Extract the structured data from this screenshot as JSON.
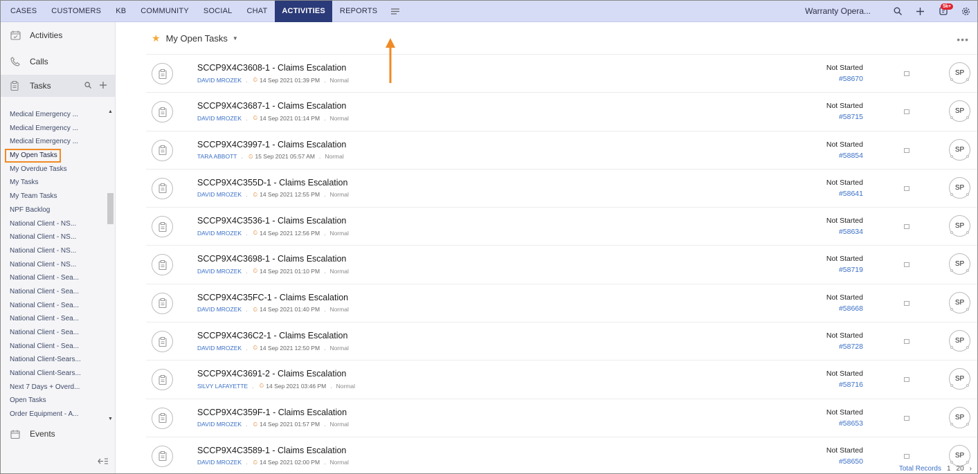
{
  "nav": {
    "items": [
      "CASES",
      "CUSTOMERS",
      "KB",
      "COMMUNITY",
      "SOCIAL",
      "CHAT",
      "ACTIVITIES",
      "REPORTS"
    ],
    "active_index": 6,
    "department": "Warranty Opera...",
    "notification_badge": "5k+"
  },
  "sidebar": {
    "activities": "Activities",
    "calls": "Calls",
    "tasks": "Tasks",
    "events": "Events",
    "views": [
      "Medical Emergency ...",
      "Medical Emergency ...",
      "Medical Emergency ...",
      "My Open Tasks",
      "My Overdue Tasks",
      "My Tasks",
      "My Team Tasks",
      "NPF Backlog",
      "National Client - NS...",
      "National Client - NS...",
      "National Client - NS...",
      "National Client - NS...",
      "National Client - Sea...",
      "National Client - Sea...",
      "National Client - Sea...",
      "National Client - Sea...",
      "National Client - Sea...",
      "National Client - Sea...",
      "National Client-Sears...",
      "National Client-Sears...",
      "Next 7 Days + Overd...",
      "Open Tasks",
      "Order Equipment - A..."
    ],
    "selected_index": 3
  },
  "main": {
    "view_title": "My Open Tasks",
    "tasks": [
      {
        "title": "SCCP9X4C3608-1 - Claims Escalation",
        "owner": "DAVID MROZEK",
        "due": "14 Sep 2021 01:39 PM",
        "priority": "Normal",
        "status": "Not Started",
        "ticket": "#58670",
        "initials": "SP"
      },
      {
        "title": "SCCP9X4C3687-1 - Claims Escalation",
        "owner": "DAVID MROZEK",
        "due": "14 Sep 2021 01:14 PM",
        "priority": "Normal",
        "status": "Not Started",
        "ticket": "#58715",
        "initials": "SP"
      },
      {
        "title": "SCCP9X4C3997-1 - Claims Escalation",
        "owner": "TARA ABBOTT",
        "due": "15 Sep 2021 05:57 AM",
        "priority": "Normal",
        "status": "Not Started",
        "ticket": "#58854",
        "initials": "SP"
      },
      {
        "title": "SCCP9X4C355D-1 - Claims Escalation",
        "owner": "DAVID MROZEK",
        "due": "14 Sep 2021 12:55 PM",
        "priority": "Normal",
        "status": "Not Started",
        "ticket": "#58641",
        "initials": "SP"
      },
      {
        "title": "SCCP9X4C3536-1 - Claims Escalation",
        "owner": "DAVID MROZEK",
        "due": "14 Sep 2021 12:56 PM",
        "priority": "Normal",
        "status": "Not Started",
        "ticket": "#58634",
        "initials": "SP"
      },
      {
        "title": "SCCP9X4C3698-1 - Claims Escalation",
        "owner": "DAVID MROZEK",
        "due": "14 Sep 2021 01:10 PM",
        "priority": "Normal",
        "status": "Not Started",
        "ticket": "#58719",
        "initials": "SP"
      },
      {
        "title": "SCCP9X4C35FC-1 - Claims Escalation",
        "owner": "DAVID MROZEK",
        "due": "14 Sep 2021 01:40 PM",
        "priority": "Normal",
        "status": "Not Started",
        "ticket": "#58668",
        "initials": "SP"
      },
      {
        "title": "SCCP9X4C36C2-1 - Claims Escalation",
        "owner": "DAVID MROZEK",
        "due": "14 Sep 2021 12:50 PM",
        "priority": "Normal",
        "status": "Not Started",
        "ticket": "#58728",
        "initials": "SP"
      },
      {
        "title": "SCCP9X4C3691-2 - Claims Escalation",
        "owner": "SILVY LAFAYETTE",
        "due": "14 Sep 2021 03:46 PM",
        "priority": "Normal",
        "status": "Not Started",
        "ticket": "#58716",
        "initials": "SP"
      },
      {
        "title": "SCCP9X4C359F-1 - Claims Escalation",
        "owner": "DAVID MROZEK",
        "due": "14 Sep 2021 01:57 PM",
        "priority": "Normal",
        "status": "Not Started",
        "ticket": "#58653",
        "initials": "SP"
      },
      {
        "title": "SCCP9X4C3589-1 - Claims Escalation",
        "owner": "DAVID MROZEK",
        "due": "14 Sep 2021 02:00 PM",
        "priority": "Normal",
        "status": "Not Started",
        "ticket": "#58650",
        "initials": "SP"
      }
    ],
    "footer": {
      "label": "Total Records",
      "page": "1",
      "page_size": "20"
    }
  },
  "colors": {
    "nav_bg": "#d7dcf6",
    "nav_active": "#2b3a78",
    "link": "#3a6fc7",
    "highlight": "#f08a25"
  }
}
